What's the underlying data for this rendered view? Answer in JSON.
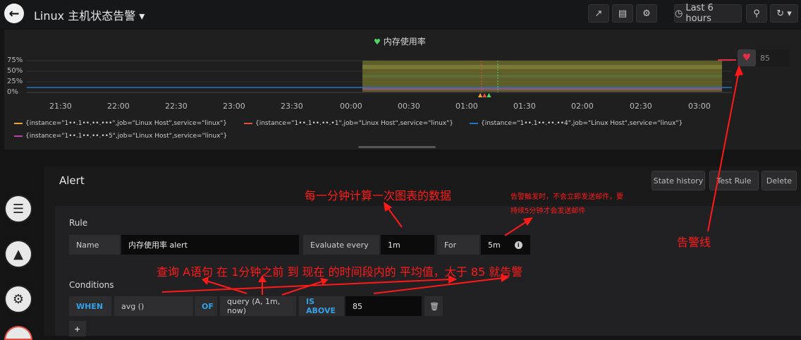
{
  "header": {
    "title": "Linux 主机状态告警",
    "time_range": "Last 6 hours"
  },
  "graph": {
    "title": "内存使用率",
    "y_ticks": [
      "75%",
      "50%",
      "25%",
      "0%"
    ],
    "x_ticks": [
      "21:30",
      "22:00",
      "22:30",
      "23:00",
      "23:30",
      "00:00",
      "00:30",
      "01:00",
      "01:30",
      "02:00",
      "02:30",
      "03:00"
    ],
    "legend": [
      {
        "label": "{instance=\"1••.1••.••.•••\",job=\"Linux Host\",service=\"linux\"}",
        "color": "#e8a33c"
      },
      {
        "label": "{instance=\"1••.1••.••.•1\",job=\"Linux Host\",service=\"linux\"}",
        "color": "#e24d42"
      },
      {
        "label": "{instance=\"1••.1••.••.••4\",job=\"Linux Host\",service=\"linux\"}",
        "color": "#1f78c1"
      },
      {
        "label": "{instance=\"1••.1••.••.••5\",job=\"Linux Host\",service=\"linux\"}",
        "color": "#ba43a9"
      }
    ],
    "threshold_value": "85"
  },
  "alert": {
    "title": "Alert",
    "buttons": {
      "state_history": "State history",
      "test_rule": "Test Rule",
      "delete": "Delete"
    },
    "rule_label": "Rule",
    "name_label": "Name",
    "name_value": "内存使用率 alert",
    "evaluate_label": "Evaluate every",
    "evaluate_value": "1m",
    "for_label": "For",
    "for_value": "5m",
    "conditions_label": "Conditions",
    "when": "WHEN",
    "reducer": "avg ()",
    "of": "OF",
    "query": "query (A, 1m, now)",
    "evaluator": "IS ABOVE",
    "threshold": "85"
  },
  "annotations": {
    "evaluate_note": "每一分钟计算一次图表的数据",
    "for_note_line1": "告警触发时，不会立即发送邮件，要",
    "for_note_line2": "持续5分钟才会发送邮件",
    "threshold_line_note": "告警线",
    "condition_note": "查询 A语句 在 1分钟之前 到 现在 的时间段内的 平均值，大于 85 就告警"
  },
  "colors": {
    "annotation": "#ff1a1a",
    "threshold_fill": "#6b6a2e",
    "heart": "#e02f44"
  }
}
